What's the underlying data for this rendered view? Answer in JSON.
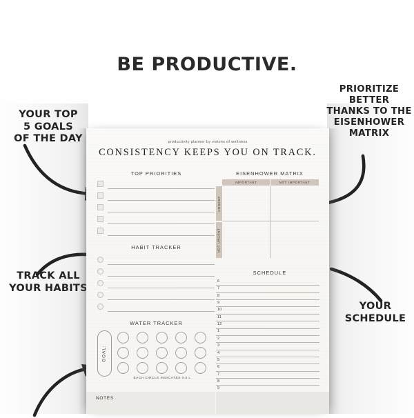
{
  "headline": "BE PRODUCTIVE.",
  "annotations": {
    "top_left": "YOUR TOP 5 GOALS OF THE DAY",
    "top_left_lines": [
      "YOUR TOP",
      "5 GOALS",
      "OF THE DAY"
    ],
    "top_right_lines": [
      "PRIORITIZE",
      "BETTER",
      "THANKS TO THE",
      "EISENHOWER",
      "MATRIX"
    ],
    "left_lower_lines": [
      "TRACK ALL",
      "YOUR HABITS"
    ],
    "right_lower_lines": [
      "YOUR",
      "SCHEDULE"
    ]
  },
  "planner": {
    "brandline": "productivity planner by visions of wellness",
    "title": "CONSISTENCY KEEPS YOU ON TRACK.",
    "top_priorities": {
      "title": "TOP PRIORITIES",
      "rows": 5,
      "values": [
        "",
        "",
        "",
        "",
        ""
      ]
    },
    "habit_tracker": {
      "title": "HABIT TRACKER",
      "rows": 5,
      "values": [
        "",
        "",
        "",
        "",
        ""
      ]
    },
    "water_tracker": {
      "title": "WATER TRACKER",
      "goal_label": "GOAL:",
      "goal_value": "",
      "circles_per_row": 5,
      "rows": 3,
      "caption": "EACH CIRCLE INDICATES 0.5 L"
    },
    "eisenhower": {
      "title": "EISENHOWER MATRIX",
      "columns": [
        "IMPORTANT",
        "NOT IMPORTANT"
      ],
      "rows": [
        "URGENT",
        "NOT URGENT"
      ],
      "quadrant_values": [
        "",
        "",
        "",
        ""
      ]
    },
    "schedule": {
      "title": "SCHEDULE",
      "hours": [
        "6",
        "7",
        "8",
        "9",
        "10",
        "11",
        "12",
        "1",
        "2",
        "3",
        "4",
        "5",
        "6",
        "7",
        "8",
        "9"
      ],
      "entries": [
        "",
        "",
        "",
        "",
        "",
        "",
        "",
        "",
        "",
        "",
        "",
        "",
        "",
        "",
        "",
        ""
      ]
    },
    "notes": {
      "label": "NOTES",
      "value": ""
    }
  },
  "colors": {
    "ink": "#232323",
    "paper": "#f8f7f5",
    "taupe": "#cfc5ba",
    "rule": "#b9b5ae",
    "notes_fill": "#eceae6"
  }
}
